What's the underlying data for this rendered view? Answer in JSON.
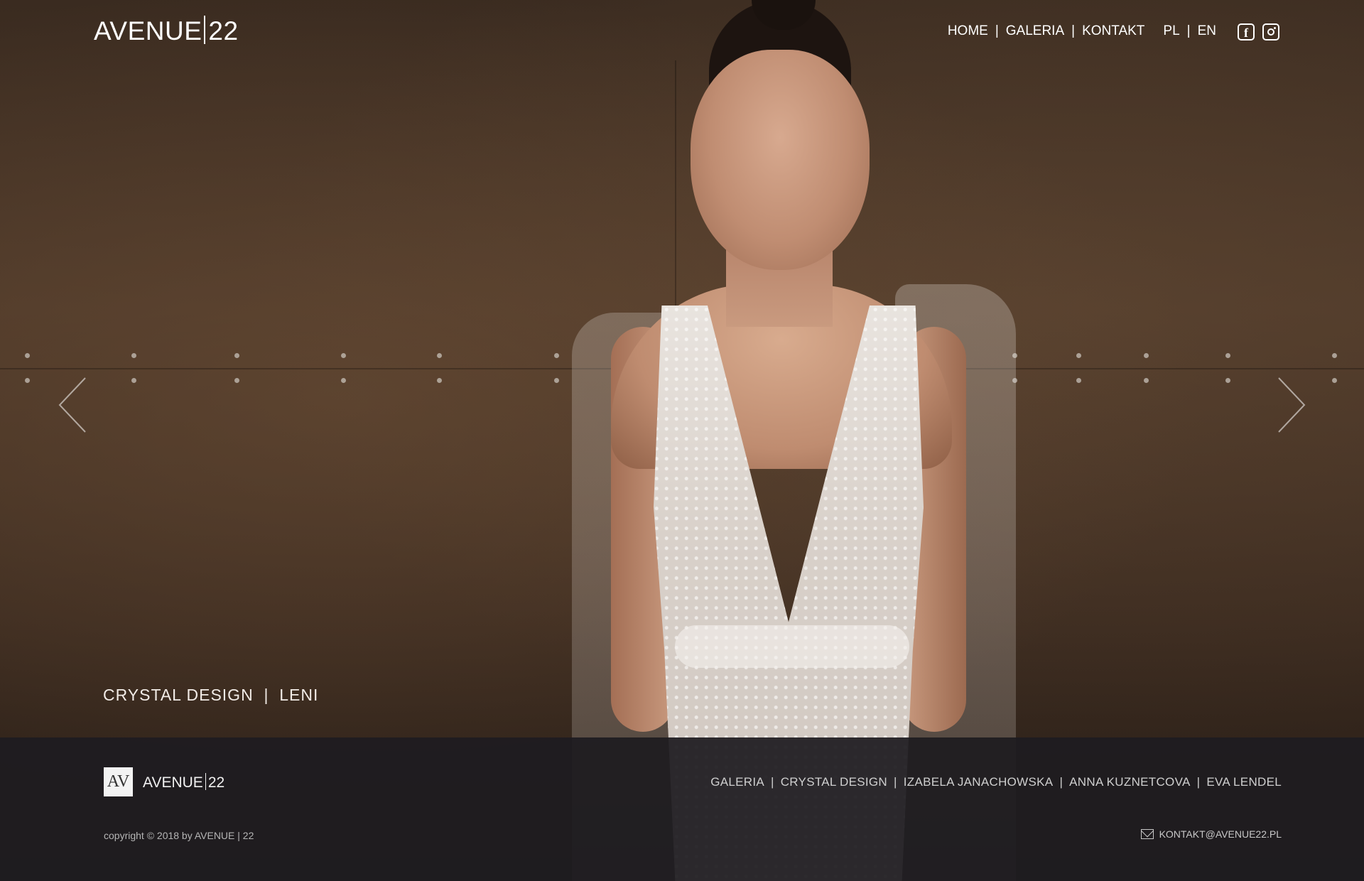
{
  "header": {
    "logo_left": "AVENUE",
    "logo_right": "22",
    "nav": [
      "HOME",
      "GALERIA",
      "KONTAKT"
    ],
    "lang": [
      "PL",
      "EN"
    ],
    "social": [
      "facebook-icon",
      "instagram-icon"
    ]
  },
  "slider": {
    "caption_brand": "CRYSTAL DESIGN",
    "caption_model": "LENI",
    "prev_icon": "chevron-left-icon",
    "next_icon": "chevron-right-icon"
  },
  "footer": {
    "mark": "AV",
    "brand_left": "AVENUE",
    "brand_right": "22",
    "links": [
      "GALERIA",
      "CRYSTAL DESIGN",
      "IZABELA JANACHOWSKA",
      "ANNA KUZNETCOVA",
      "EVA LENDEL"
    ],
    "copyright": "copyright © 2018 by AVENUE | 22",
    "email": "KONTAKT@AVENUE22.PL"
  },
  "colors": {
    "footer_bg": "#1e1c20",
    "text": "#ffffff"
  }
}
